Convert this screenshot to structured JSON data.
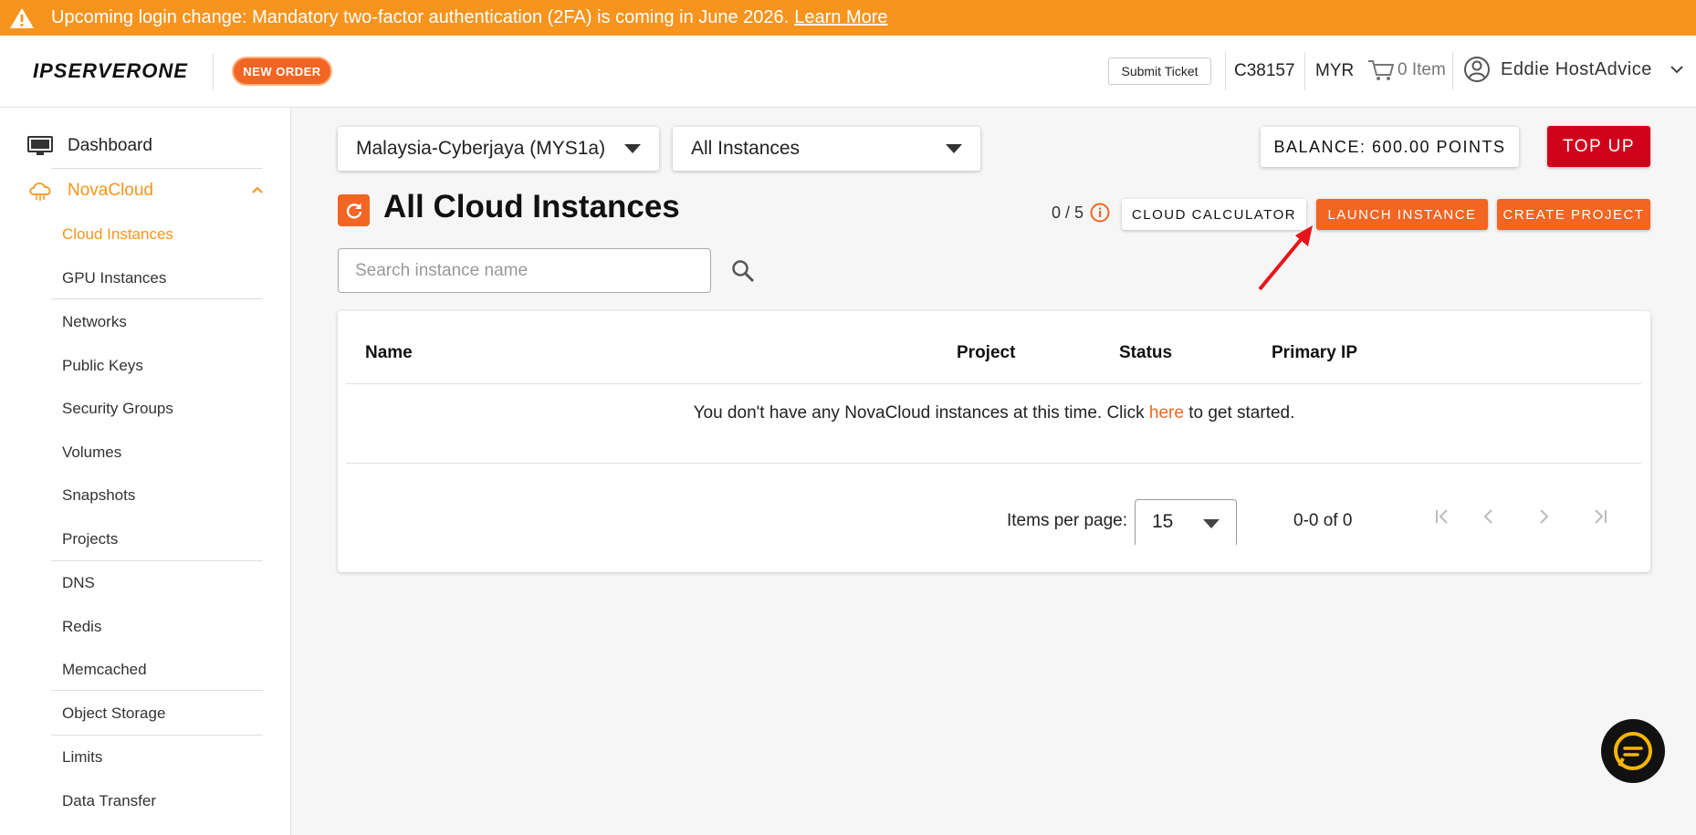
{
  "banner": {
    "message": "Upcoming login change: Mandatory two-factor authentication (2FA) is coming in June 2026.",
    "link": "Learn More",
    "icon": "warning-icon",
    "color": "#f7941d"
  },
  "header": {
    "logo": "IPSERVERONE",
    "new_order": "NEW ORDER",
    "submit_ticket": "Submit Ticket",
    "client_id": "C38157",
    "currency": "MYR",
    "cart": "0 Item",
    "user": "Eddie HostAdvice"
  },
  "sidebar": {
    "dashboard": "Dashboard",
    "section": "NovaCloud",
    "items": [
      "Cloud Instances",
      "GPU Instances",
      "Networks",
      "Public Keys",
      "Security Groups",
      "Volumes",
      "Snapshots",
      "Projects",
      "DNS",
      "Redis",
      "Memcached",
      "Object Storage",
      "Limits",
      "Data Transfer"
    ],
    "active_item": "Cloud Instances",
    "accent_color": "#f7941d"
  },
  "filters": {
    "region": "Malaysia-Cyberjaya (MYS1a)",
    "instances": "All Instances"
  },
  "balance": "BALANCE: 600.00 POINTS",
  "top_up": "TOP UP",
  "page_title": "All Cloud Instances",
  "quota": "0 / 5",
  "buttons": {
    "calculator": "CLOUD CALCULATOR",
    "launch": "LAUNCH INSTANCE",
    "create_project": "CREATE PROJECT"
  },
  "search": {
    "placeholder": "Search instance name",
    "value": ""
  },
  "table": {
    "columns": [
      "Name",
      "Project",
      "Status",
      "Primary IP"
    ],
    "empty_prefix": "You don't have any NovaCloud instances at this time. Click ",
    "empty_link": "here",
    "empty_suffix": " to get started."
  },
  "pagination": {
    "label": "Items per page:",
    "per_page": "15",
    "range": "0-0 of 0"
  },
  "brand_orange": "#f26522",
  "danger_red": "#d0021b"
}
